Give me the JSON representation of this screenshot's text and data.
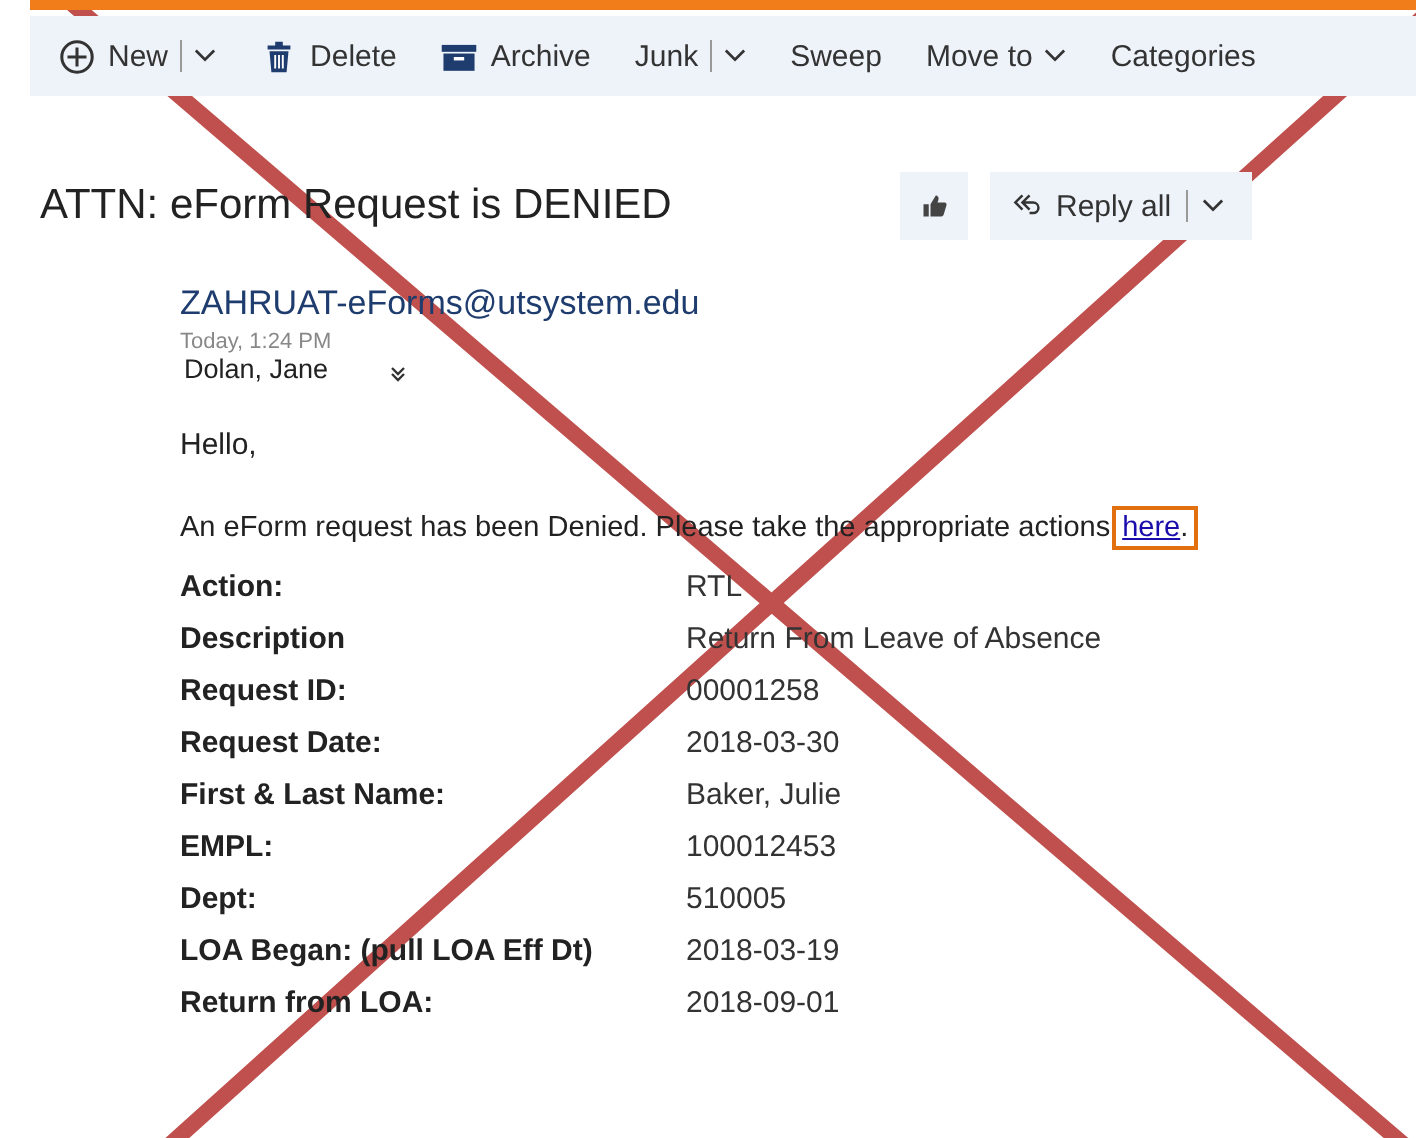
{
  "toolbar": [
    {
      "label": "New",
      "kind": "split"
    },
    {
      "label": "Delete",
      "kind": "plain"
    },
    {
      "label": "Archive",
      "kind": "plain"
    },
    {
      "label": "Junk",
      "kind": "split"
    },
    {
      "label": "Sweep",
      "kind": "plain"
    },
    {
      "label": "Move to",
      "kind": "dropdown"
    },
    {
      "label": "Categories",
      "kind": "plain"
    }
  ],
  "message": {
    "subject": "ATTN: eForm Request is DENIED",
    "reply_button": "Reply all",
    "sender": "ZAHRUAT-eForms@utsystem.edu",
    "time": "Today, 1:24 PM",
    "recipient": "Dolan, Jane",
    "greeting": "Hello,",
    "body": "An eForm request has been Denied. Please take the appropriate actions",
    "link": "here",
    "link_end": ".",
    "fields": [
      {
        "label": "Action:",
        "value": "RTL"
      },
      {
        "label": "Description",
        "value": "Return From Leave of Absence"
      },
      {
        "label": "Request ID:",
        "value": "00001258"
      },
      {
        "label": "Request Date:",
        "value": "2018-03-30"
      },
      {
        "label": "First & Last Name:",
        "value": "Baker, Julie"
      },
      {
        "label": "EMPL:",
        "value": "100012453"
      },
      {
        "label": "Dept:",
        "value": "510005"
      },
      {
        "label": "LOA Began: (pull LOA Eff Dt)",
        "value": "2018-03-19"
      },
      {
        "label": "Return from LOA:",
        "value": "2018-09-01"
      }
    ]
  }
}
